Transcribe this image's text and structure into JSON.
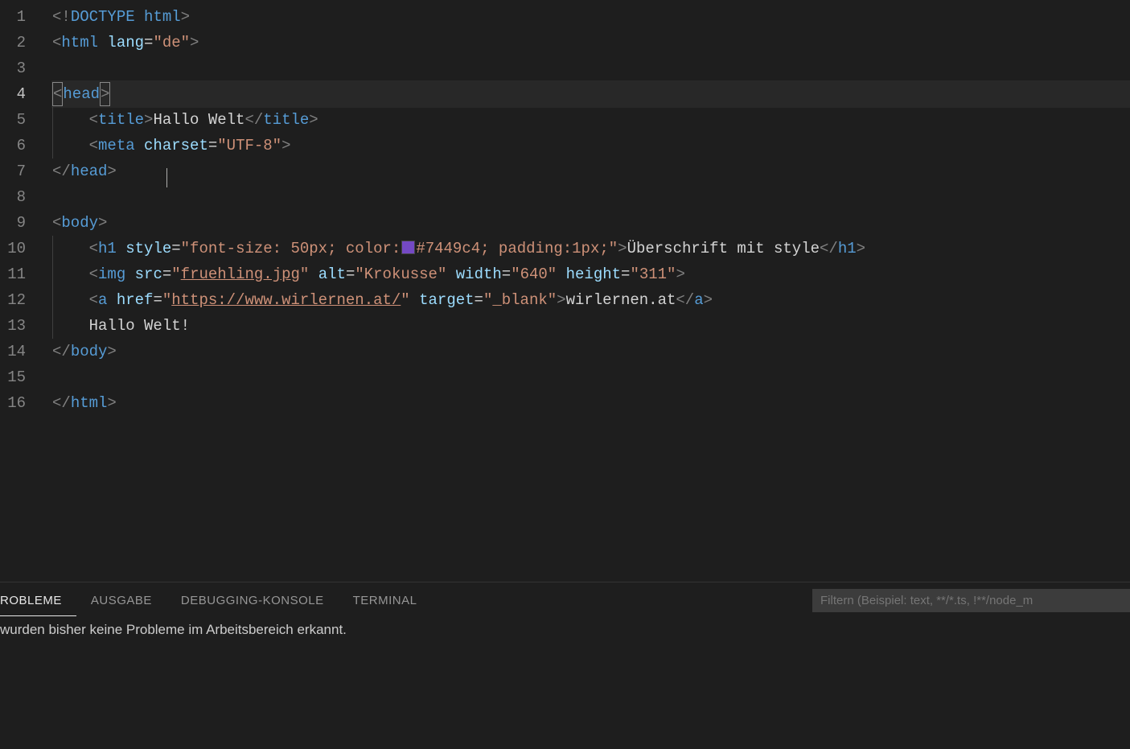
{
  "gutter": {
    "lines": [
      "1",
      "2",
      "3",
      "4",
      "5",
      "6",
      "7",
      "8",
      "9",
      "10",
      "11",
      "12",
      "13",
      "14",
      "15",
      "16"
    ],
    "activeLine": "4"
  },
  "code": {
    "l1": {
      "doctype": "DOCTYPE",
      "word": "html"
    },
    "l2": {
      "tag": "html",
      "attr": "lang",
      "val": "\"de\""
    },
    "l4": {
      "tag": "head"
    },
    "l5": {
      "tag_open": "title",
      "text": "Hallo Welt",
      "tag_close": "title"
    },
    "l6": {
      "tag": "meta",
      "attr": "charset",
      "val": "\"UTF-8\""
    },
    "l7": {
      "tag": "head"
    },
    "l9": {
      "tag": "body"
    },
    "l10": {
      "tag": "h1",
      "attr": "style",
      "val1": "\"font-size: 50px; color:",
      "val2": "#7449c4; padding:1px;\"",
      "text": "Überschrift mit style",
      "tag_close": "h1",
      "swatch_color": "#7449c4"
    },
    "l11": {
      "tag": "img",
      "attr_src": "src",
      "val_src_q1": "\"",
      "val_src_link": "fruehling.jpg",
      "val_src_q2": "\"",
      "attr_alt": "alt",
      "val_alt": "\"Krokusse\"",
      "attr_w": "width",
      "val_w": "\"640\"",
      "attr_h": "height",
      "val_h": "\"311\""
    },
    "l12": {
      "tag": "a",
      "attr_href": "href",
      "val_href_q1": "\"",
      "val_href_link": "https://www.wirlernen.at/",
      "val_href_q2": "\"",
      "attr_tgt": "target",
      "val_tgt": "\"_blank\"",
      "text": "wirlernen.at",
      "tag_close": "a"
    },
    "l13": {
      "text": "Hallo Welt!"
    },
    "l14": {
      "tag": "body"
    },
    "l16": {
      "tag": "html"
    }
  },
  "panel": {
    "tabs": {
      "probleme": "ROBLEME",
      "ausgabe": "AUSGABE",
      "debugkonsole": "DEBUGGING-KONSOLE",
      "terminal": "TERMINAL"
    },
    "filter_placeholder": "Filtern (Beispiel: text, **/*.ts, !**/node_m",
    "message": " wurden bisher keine Probleme im Arbeitsbereich erkannt."
  }
}
